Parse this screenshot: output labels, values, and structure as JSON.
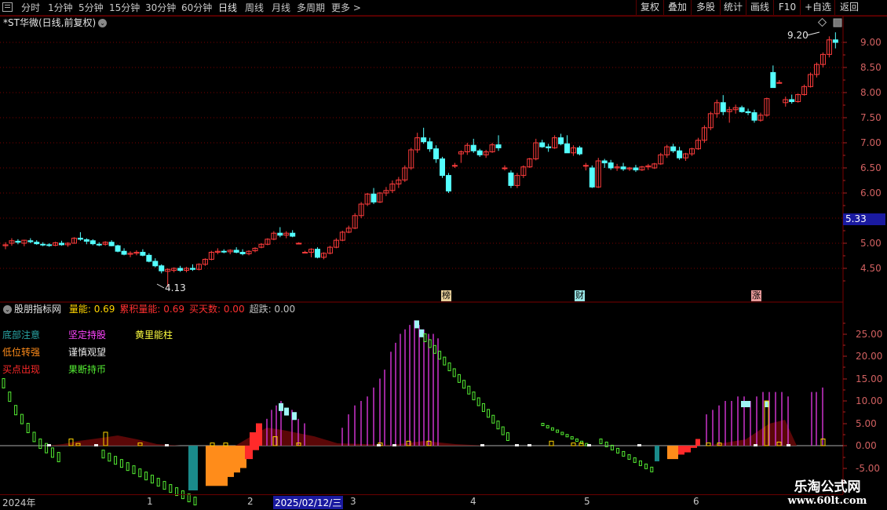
{
  "toolbar": {
    "periods": [
      "分时",
      "1分钟",
      "5分钟",
      "15分钟",
      "30分钟",
      "60分钟",
      "日线",
      "周线",
      "月线",
      "多周期",
      "更多 >"
    ],
    "active_period": "日线",
    "right_buttons": [
      "复权",
      "叠加",
      "多股",
      "统计",
      "画线",
      "F10",
      "+自选",
      "返回"
    ]
  },
  "stock": {
    "title": "*ST华微(日线,前复权)"
  },
  "main_chart": {
    "price_ticks": [
      "9.00",
      "8.50",
      "8.00",
      "7.50",
      "7.00",
      "6.50",
      "6.00",
      "5.00",
      "4.50"
    ],
    "current_price_label": "5.33",
    "max_label": "9.20",
    "min_label": "4.13",
    "tags": [
      "榜",
      "财",
      "涨"
    ]
  },
  "indicator": {
    "name": "股朋指标网",
    "values": [
      {
        "label": "量能:",
        "value": "0.69",
        "color": "#ffd400"
      },
      {
        "label": "累积量能:",
        "value": "0.69",
        "color": "#ff3030"
      },
      {
        "label": "买天数:",
        "value": "0.00",
        "color": "#ff3030"
      },
      {
        "label": "超跌:",
        "value": "0.00",
        "color": "#c0c0c0"
      }
    ],
    "legend": [
      {
        "text": "底部注意",
        "color": "#2aa6a6"
      },
      {
        "text": "坚定持股",
        "color": "#ff44ff"
      },
      {
        "text": "黄里能柱",
        "color": "#ffff40"
      },
      {
        "text": "低位转强",
        "color": "#ff8c1a"
      },
      {
        "text": "谨慎观望",
        "color": "#e8e8e8"
      },
      {
        "text": "买点出现",
        "color": "#ff2a2a"
      },
      {
        "text": "果断持币",
        "color": "#55ee33"
      }
    ],
    "axis_ticks": [
      "25.00",
      "20.00",
      "15.00",
      "10.00",
      "5.00",
      "0.00",
      "-5.00"
    ]
  },
  "date_axis": {
    "labels": [
      "2024年",
      "1",
      "2",
      "2025/02/12/三",
      "3",
      "4",
      "5",
      "6"
    ]
  },
  "watermark": {
    "line1": "乐淘公式网",
    "line2": "www.60lt.com"
  },
  "colors": {
    "up": "#ff3c3c",
    "down": "#54ffff",
    "grid": "#7a0000"
  }
}
